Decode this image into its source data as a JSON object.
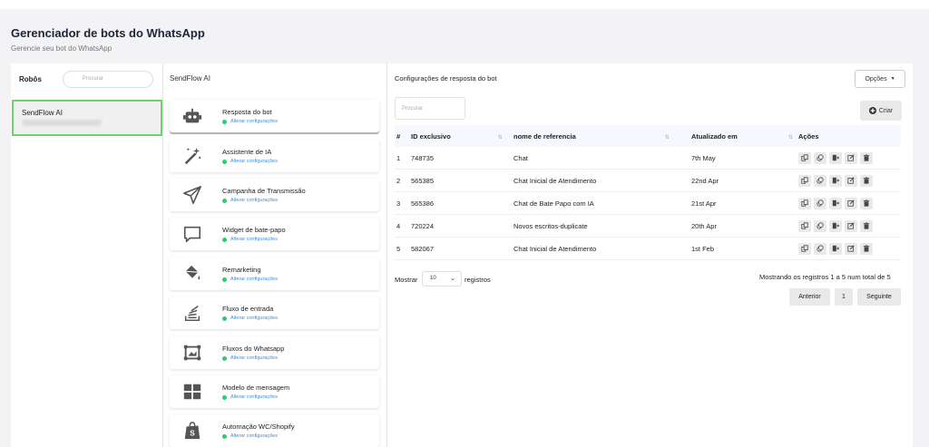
{
  "header": {
    "title": "Gerenciador de bots do WhatsApp",
    "subtitle": "Gerencie seu bot do WhatsApp"
  },
  "bots": {
    "label": "Robôs",
    "search_placeholder": "Procurar",
    "items": [
      {
        "name": "SendFlow AI"
      }
    ]
  },
  "features": {
    "title": "SendFlow AI",
    "link_label": "Alterar configurações",
    "items": [
      {
        "label": "Resposta do bot",
        "icon": "robot-icon"
      },
      {
        "label": "Assistente de IA",
        "icon": "magic-wand-icon"
      },
      {
        "label": "Campanha de Transmissão",
        "icon": "paper-plane-icon"
      },
      {
        "label": "Widget de bate-papo",
        "icon": "chat-bubble-icon"
      },
      {
        "label": "Remarketing",
        "icon": "paint-bucket-icon"
      },
      {
        "label": "Fluxo de entrada",
        "icon": "stack-icon"
      },
      {
        "label": "Fluxos do Whatsapp",
        "icon": "frame-icon"
      },
      {
        "label": "Modelo de mensagem",
        "icon": "grid-icon"
      },
      {
        "label": "Automação WC/Shopify",
        "icon": "shopify-bag-icon"
      }
    ]
  },
  "config": {
    "title": "Configurações de resposta do bot",
    "options_label": "Opções",
    "create_label": "Criar",
    "search_placeholder": "Procurar",
    "columns": [
      "#",
      "ID exclusivo",
      "nome de referencia",
      "Atualizado em",
      "Ações"
    ],
    "rows": [
      {
        "num": "1",
        "id": "748735",
        "name": "Chat",
        "updated": "7th May"
      },
      {
        "num": "2",
        "id": "565385",
        "name": "Chat Inicial de Atendimento",
        "updated": "22nd Apr"
      },
      {
        "num": "3",
        "id": "565386",
        "name": "Chat de Bate Papo com IA",
        "updated": "21st Apr"
      },
      {
        "num": "4",
        "id": "720224",
        "name": "Novos escritos-duplicate",
        "updated": "20th Apr"
      },
      {
        "num": "5",
        "id": "582067",
        "name": "Chat Inicial de Atendimento",
        "updated": "1st Feb"
      }
    ],
    "show_label": "Mostrar",
    "page_size": "10",
    "registros_label": "registros",
    "info": "Mostrando os registros 1 a 5 num total de 5",
    "prev_label": "Anterior",
    "page_number": "1",
    "next_label": "Seguinte"
  },
  "colors": {
    "accent_green": "#6fd46f",
    "link_blue": "#3a8fd6",
    "status_dot": "#2ecc71"
  }
}
